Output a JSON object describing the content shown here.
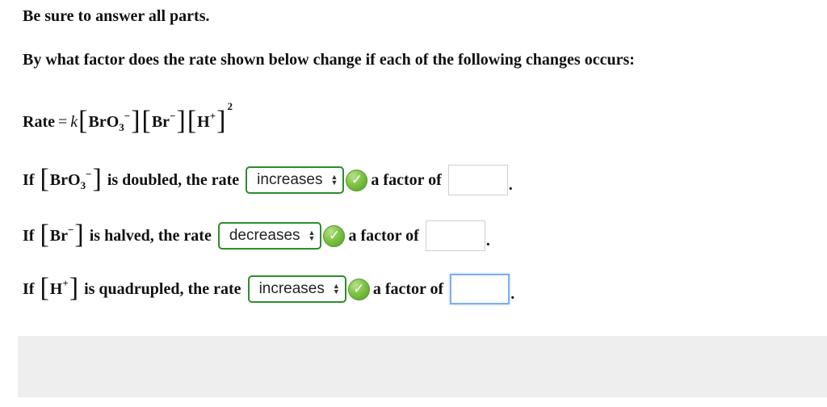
{
  "instructions": "Be sure to answer all parts.",
  "question": "By what factor does the rate shown below change if each of the following changes occurs:",
  "rate_law": {
    "lhs": "Rate",
    "equals": "=",
    "constant": "k",
    "bro3_base": "BrO",
    "bro3_sub": "3",
    "anion_charge": "−",
    "br_base": "Br",
    "h_base": "H",
    "h_charge": "+",
    "exponent": "2",
    "lbracket": "[",
    "rbracket": "]"
  },
  "rows": [
    {
      "prefix": "If",
      "species_base": "BrO",
      "species_sub": "3",
      "species_charge": "−",
      "middle": "is doubled, the rate",
      "selected": "increases",
      "suffix": "a factor of",
      "answer": "",
      "check": "✓",
      "period": "."
    },
    {
      "prefix": "If",
      "species_base": "Br",
      "species_charge": "−",
      "middle": "is halved, the rate",
      "selected": "decreases",
      "suffix": "a factor of",
      "answer": "",
      "check": "✓",
      "period": "."
    },
    {
      "prefix": "If",
      "species_base": "H",
      "species_charge": "+",
      "middle": "is quadrupled, the rate",
      "selected": "increases",
      "suffix": "a factor of",
      "answer": "",
      "check": "✓",
      "period": "."
    }
  ],
  "icons": {
    "correct": "check-circle-icon",
    "select": "updown-arrows-icon"
  },
  "colors": {
    "select_border": "#2e8b2e",
    "check_green": "#7cc242",
    "focus_blue": "#7fb0ea",
    "footer_bg": "#eeeeee"
  }
}
